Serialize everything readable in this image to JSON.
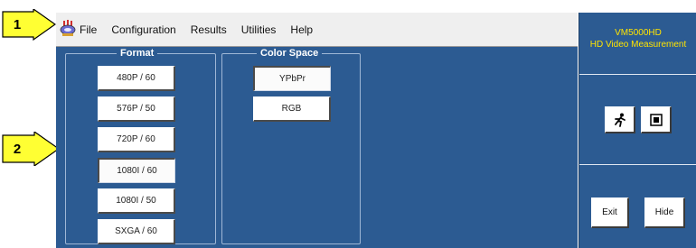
{
  "callouts": [
    "1",
    "2"
  ],
  "menu": {
    "app_icon": "app-logo-icon",
    "items": [
      "File",
      "Configuration",
      "Results",
      "Utilities",
      "Help"
    ]
  },
  "format": {
    "title": "Format",
    "options": [
      "480P / 60",
      "576P / 50",
      "720P / 60",
      "1080I / 60",
      "1080I / 50",
      "SXGA / 60"
    ],
    "selected": "1080I / 60"
  },
  "color_space": {
    "title": "Color Space",
    "options": [
      "YPbPr",
      "RGB"
    ],
    "selected": "YPbPr"
  },
  "side": {
    "product": "VM5000HD",
    "subtitle": "HD Video Measurement",
    "run_icon": "running-man-icon",
    "stop_icon": "stop-icon",
    "exit_label": "Exit",
    "hide_label": "Hide"
  },
  "colors": {
    "panel": "#2c5b92",
    "menubar": "#efefef",
    "side_title": "#ffe400",
    "callout": "#ffff33"
  }
}
